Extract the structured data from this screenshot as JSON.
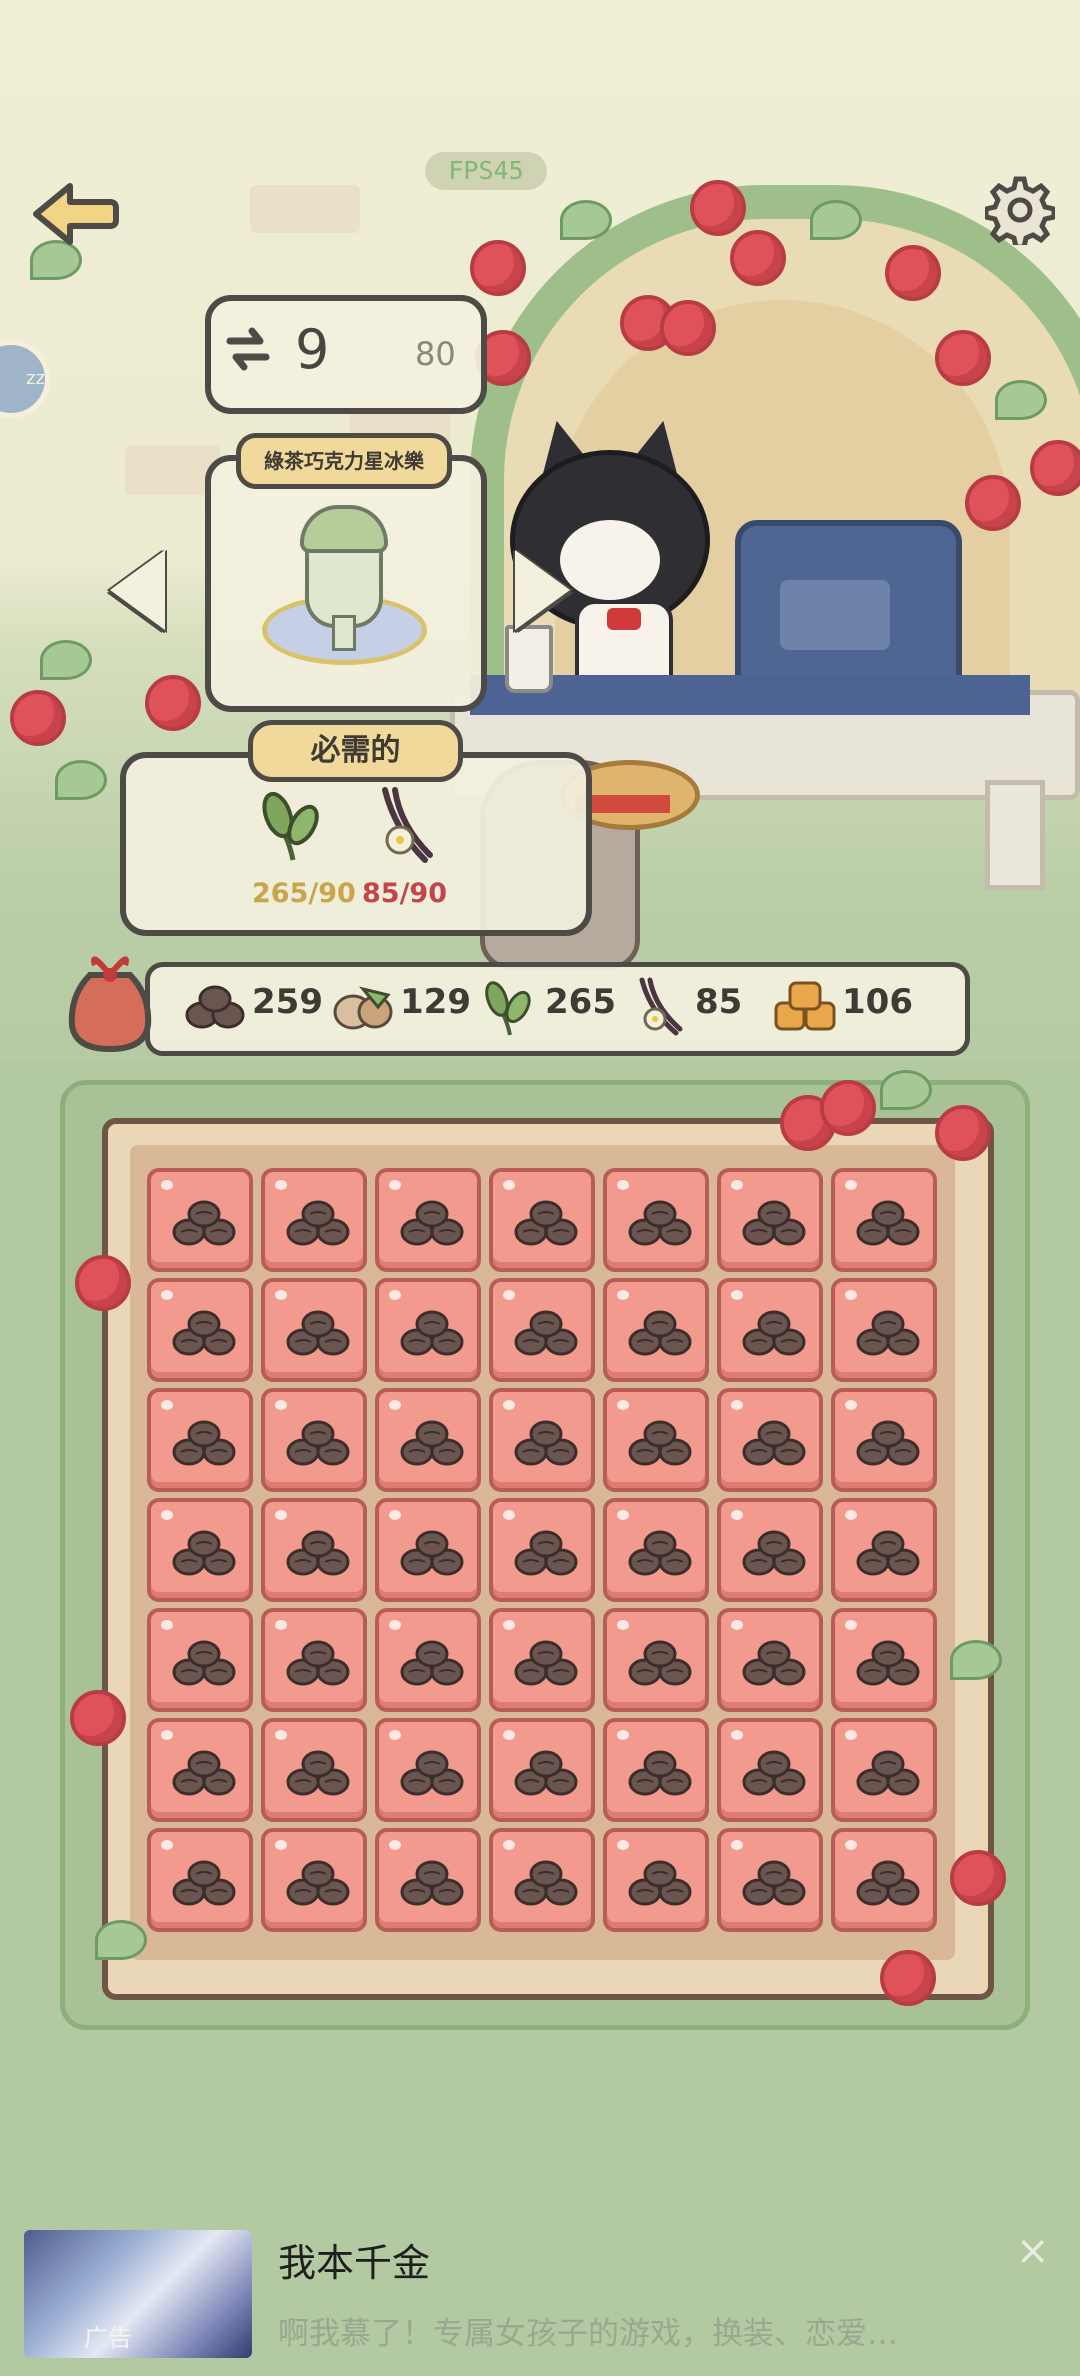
{
  "fps_badge": "FPS45",
  "side_bubble_text": "zz",
  "counter": {
    "value": "9",
    "max": "80"
  },
  "recipe": {
    "name": "綠茶巧克力星冰樂"
  },
  "required": {
    "title": "必需的",
    "items": [
      {
        "icon": "green-tea-leaf-icon",
        "count": "265/90",
        "color": "#c9a44a"
      },
      {
        "icon": "vanilla-icon",
        "count": "85/90",
        "color": "#c2454a"
      }
    ]
  },
  "inventory": [
    {
      "icon": "coffee-bean-icon",
      "count": "259"
    },
    {
      "icon": "hazelnut-icon",
      "count": "129"
    },
    {
      "icon": "green-tea-leaf-icon",
      "count": "265"
    },
    {
      "icon": "vanilla-icon",
      "count": "85"
    },
    {
      "icon": "bread-icon",
      "count": "106"
    }
  ],
  "grid": {
    "rows": 7,
    "columns": 7,
    "tile_item": "coffee-bean-icon"
  },
  "ad": {
    "title": "我本千金",
    "description": "啊我慕了！专属女孩子的游戏，换装、恋爱…",
    "label": "广告",
    "close": "×"
  },
  "colors": {
    "tile": "#f29a8d",
    "tile_border": "#b85d56",
    "panel_bg": "#f3f0de",
    "panel_border": "#4e4a45",
    "garden": "#b3c9a1"
  }
}
